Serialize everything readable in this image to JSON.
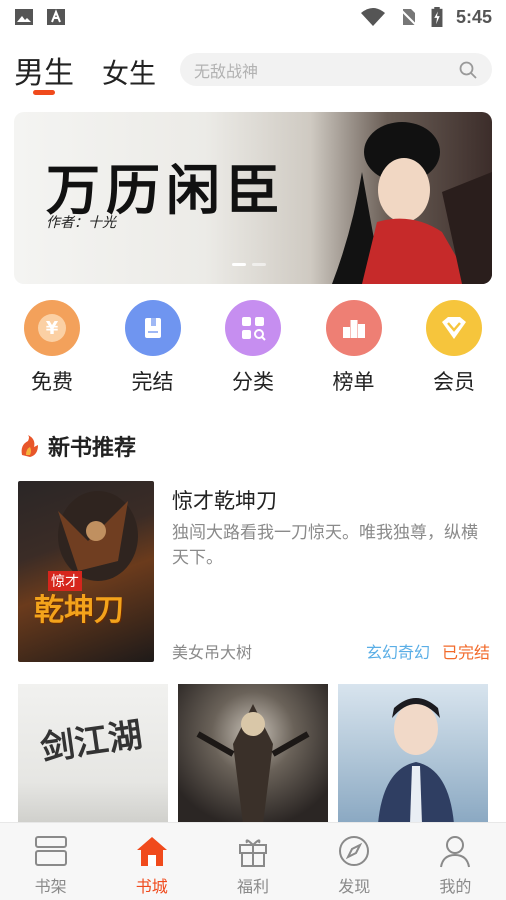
{
  "status_bar": {
    "time": "5:45"
  },
  "header": {
    "tabs": [
      {
        "label": "男生"
      },
      {
        "label": "女生"
      }
    ],
    "search_placeholder": "无敌战神"
  },
  "banner": {
    "title": "万历闲臣",
    "author_line": "作者：十光"
  },
  "categories": [
    {
      "label": "免费",
      "icon": "yen-icon",
      "color": "#f3a15b"
    },
    {
      "label": "完结",
      "icon": "book-icon",
      "color": "#6f95f0"
    },
    {
      "label": "分类",
      "icon": "category-icon",
      "color": "#c68ef0"
    },
    {
      "label": "榜单",
      "icon": "ranking-icon",
      "color": "#ee7f74"
    },
    {
      "label": "会员",
      "icon": "diamond-icon",
      "color": "#f6c53c"
    }
  ],
  "section": {
    "title": "新书推荐"
  },
  "featured_book": {
    "cover_tag": "惊才",
    "cover_title": "乾坤刀",
    "title": "惊才乾坤刀",
    "description": "独闯大路看我一刀惊天。唯我独尊，纵横天下。",
    "author": "美女吊大树",
    "genre": "玄幻奇幻",
    "status": "已完结"
  },
  "more_covers": [
    {
      "title_art": "剑江湖"
    },
    {
      "title_art": ""
    },
    {
      "title_art": ""
    }
  ],
  "bottom_nav": [
    {
      "label": "书架",
      "icon": "bookshelf-icon"
    },
    {
      "label": "书城",
      "icon": "home-icon",
      "active": true
    },
    {
      "label": "福利",
      "icon": "gift-icon"
    },
    {
      "label": "发现",
      "icon": "compass-icon"
    },
    {
      "label": "我的",
      "icon": "profile-icon"
    }
  ],
  "colors": {
    "accent": "#f04a1c",
    "genre": "#5aaee6",
    "status": "#f26a2a"
  }
}
